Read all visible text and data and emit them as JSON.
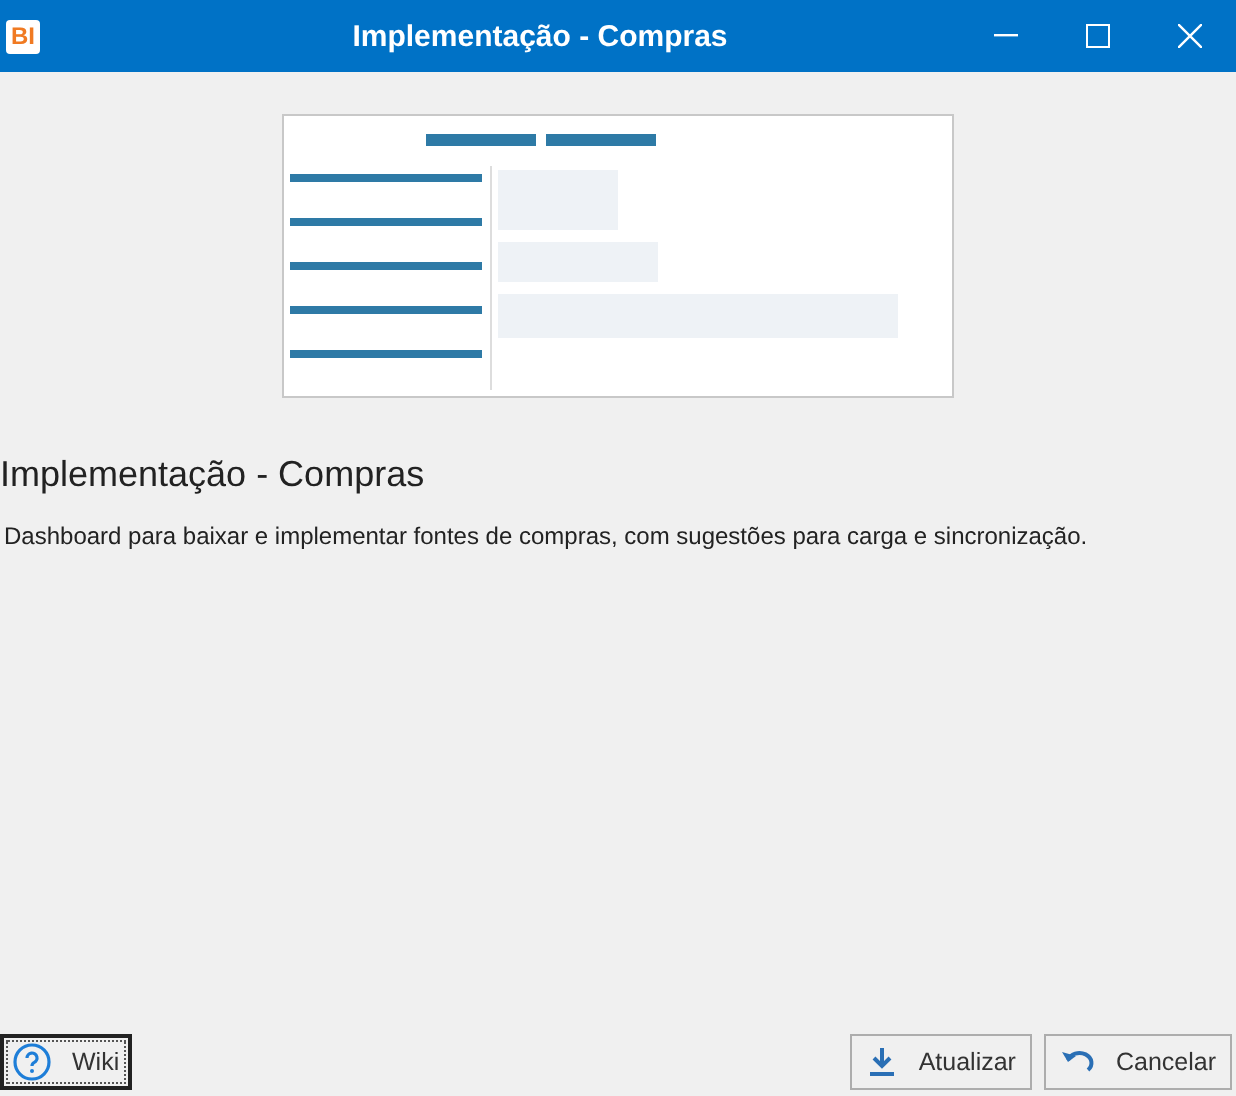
{
  "window": {
    "title": "Implementação - Compras",
    "logo": "BI"
  },
  "heading": "Implementação - Compras",
  "description": "Dashboard para baixar e implementar fontes de compras, com sugestões para carga e sincronização.",
  "buttons": [
    {
      "label": "Wiki",
      "kind": "help",
      "focused": true
    },
    {
      "label": "Atualizar",
      "kind": "download",
      "focused": false
    },
    {
      "label": "Cancelar",
      "kind": "undo",
      "focused": false
    }
  ]
}
